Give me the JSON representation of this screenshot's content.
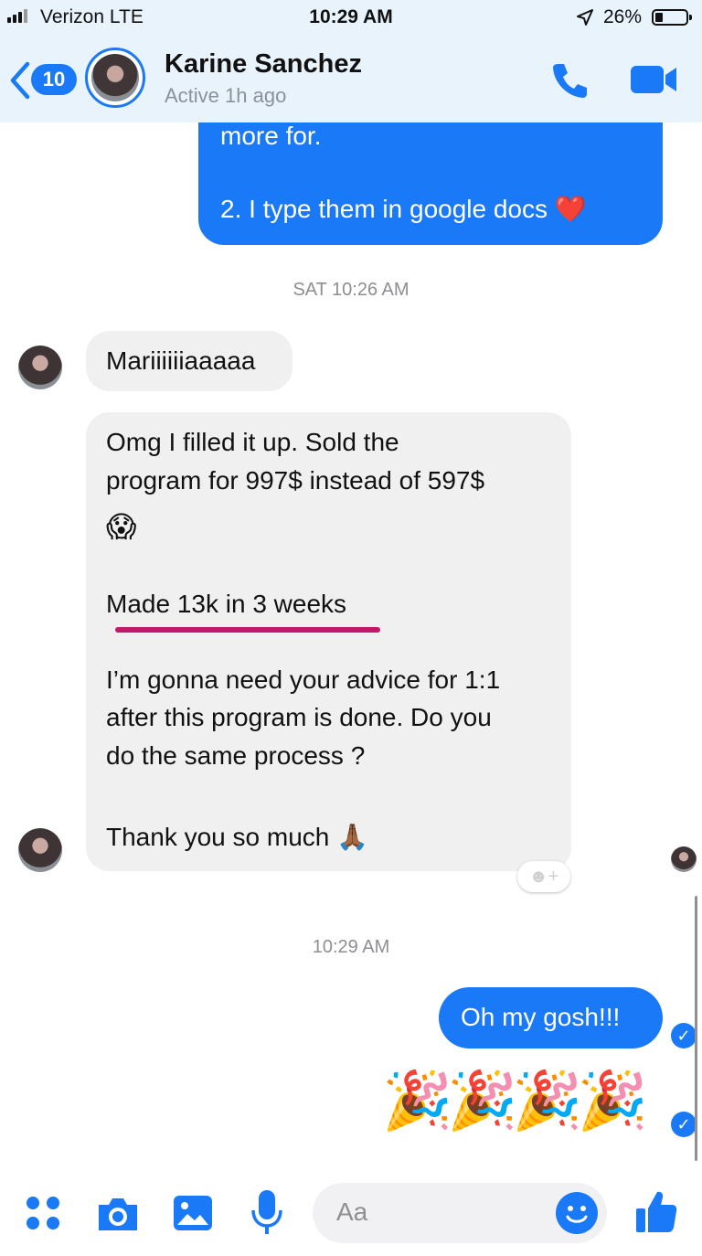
{
  "status_bar": {
    "carrier": "Verizon  LTE",
    "time": "10:29 AM",
    "battery_pct": "26%",
    "battery_level": 0.26
  },
  "header": {
    "back_badge": "10",
    "contact_name": "Karine Sanchez",
    "status": "Active 1h ago",
    "icons": [
      "back-chevron-icon",
      "phone-icon",
      "video-camera-icon"
    ],
    "accent_color": "#1a79f6"
  },
  "messages": {
    "first_out_cut": "more for.",
    "first_out_line": "2. I type them in google docs ❤️",
    "timestamp_1": "SAT 10:26 AM",
    "in_1": "Mariiiiiiaaaaa",
    "in_2_line_1": "Omg I filled it up. Sold the",
    "in_2_line_2": "program for 997$ instead of 597$",
    "in_2_emoji": "😱",
    "in_2_line_3": "Made 13k in 3 weeks",
    "in_2_line_4": "I’m gonna need your advice for 1:1",
    "in_2_line_5": "after this program is done. Do you",
    "in_2_line_6": "do the same process ?",
    "in_2_line_7": "Thank you so much 🙏🏾",
    "timestamp_2": "10:29 AM",
    "out_2": "Oh my gosh!!!",
    "out_3_emoji": "🎉🎉🎉🎉",
    "react_add": "☻+"
  },
  "composer": {
    "placeholder": "Aa",
    "icons": [
      "apps-grid-icon",
      "camera-icon",
      "photo-icon",
      "microphone-icon",
      "emoji-icon",
      "thumbs-up-icon"
    ]
  }
}
